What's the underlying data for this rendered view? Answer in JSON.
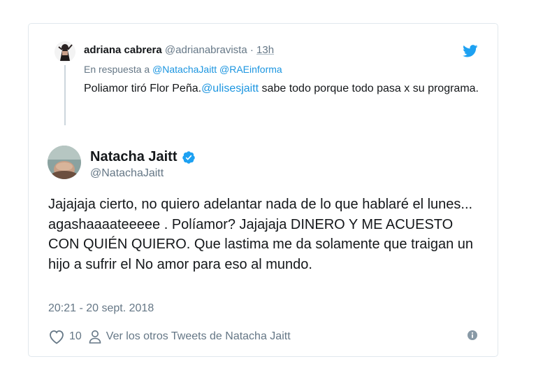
{
  "parent_tweet": {
    "name": "adriana cabrera",
    "handle": "@adrianabravista",
    "separator": "·",
    "time": "13h",
    "reply_prefix": "En respuesta a",
    "reply_mentions": [
      "@NatachaJaitt",
      "@RAEinforma"
    ],
    "text_before": "Poliamor tiró Flor Peña.",
    "text_mention": "@ulisesjaitt",
    "text_after": " sabe todo porque todo pasa x su programa."
  },
  "main_tweet": {
    "name": "Natacha Jaitt",
    "handle": "@NatachaJaitt",
    "text": "Jajajaja cierto, no quiero adelantar nada de lo  que hablaré el lunes... agashaaaateeeee . Políamor? Jajajaja DINERO Y ME ACUESTO CON QUIÉN QUIERO. Que lastima me da solamente que traigan un hijo a sufrir el No amor para eso al mundo.",
    "timestamp": "20:21 - 20 sept. 2018"
  },
  "actions": {
    "like_count": "10",
    "other_tweets_label": "Ver los otros Tweets de Natacha Jaitt"
  },
  "icons": {
    "brand": "twitter-bird-icon",
    "verified": "verified-badge-icon",
    "like": "heart-icon",
    "profile": "person-icon",
    "info": "info-icon"
  },
  "colors": {
    "accent": "#1da1f2",
    "link": "#1b95e0",
    "muted": "#657786",
    "text": "#14171a",
    "border": "#e1e8ed"
  }
}
